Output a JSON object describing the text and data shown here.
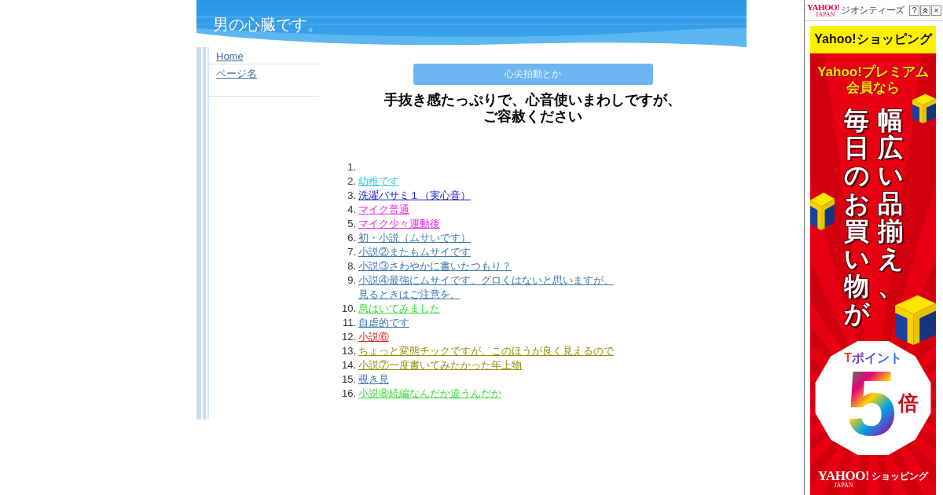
{
  "header": {
    "title": "男の心臓です。"
  },
  "nav": {
    "items": [
      {
        "label": "Home"
      },
      {
        "label": "ページ名"
      }
    ]
  },
  "main": {
    "button": "心尖拍動とか",
    "heading": "手抜き感たっぷりで、心音使いまわしですが、ご容赦ください",
    "list": [
      {
        "number": "1."
      },
      {
        "number": "2.",
        "label": "幼稚です",
        "color": "#33ccee"
      },
      {
        "number": "3.",
        "label": "洗濯バサミ１（実心音）",
        "color": "#1a1acc"
      },
      {
        "number": "4.",
        "label": "マイク普通",
        "color": "#ee22ee"
      },
      {
        "number": "5.",
        "label": "マイク少々運動後",
        "color": "#ee22ee"
      },
      {
        "number": "6.",
        "label": "初・小説（ムサいです）",
        "color": "#3a78b0"
      },
      {
        "number": "7.",
        "label": "小説②またもムサイです",
        "color": "#3a78b0"
      },
      {
        "number": "8.",
        "label": "小説③さわやかに書いたつもり？",
        "color": "#3a78b0"
      },
      {
        "number": "9.",
        "label": "小説④最強にムサイです。グロくはないと思いますが、見るときはご注意を。",
        "color": "#3a78b0"
      },
      {
        "number": "10.",
        "label": "息はいてみました",
        "color": "#33dd33"
      },
      {
        "number": "11.",
        "label": "自虐的です",
        "color": "#3a78b0"
      },
      {
        "number": "12.",
        "label": "小説⑥",
        "color": "#ee1c1c"
      },
      {
        "number": "13.",
        "label": "ちょっと変態チックですが、このほうが良く見えるので",
        "color": "#8f8f10"
      },
      {
        "number": "14.",
        "label": "小説⑦一度書いてみたかった年上物",
        "color": "#8f8f10"
      },
      {
        "number": "15.",
        "label": "覗き見",
        "color": "#3a78b0"
      },
      {
        "number": "16.",
        "label": "小説⑧続編なんだか違うんだか",
        "color": "#33dd33"
      }
    ]
  },
  "ad": {
    "toolbar": {
      "logo": "YAHOO!",
      "logo_sub": "JAPAN",
      "service": "ジオシティーズ",
      "buttons": [
        {
          "kind": "help",
          "label": "?"
        },
        {
          "kind": "collapse"
        },
        {
          "kind": "close",
          "label": "×"
        }
      ]
    },
    "banner": {
      "title": "Yahoo!ショッピング",
      "lines": [
        "Yahoo!プレミアム",
        "会員なら"
      ],
      "vertical_columns": [
        "毎日のお買い物が",
        "幅広い品揃え、"
      ],
      "points_label": "Tポイント",
      "multiplier": "5",
      "multiplier_unit": "倍",
      "footer_logo": "YAHOO!",
      "footer_logo_sub": "JAPAN",
      "footer_service": "ショッピング"
    }
  }
}
